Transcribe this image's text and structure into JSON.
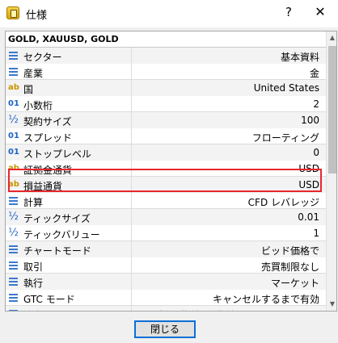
{
  "window": {
    "title": "仕様",
    "help": "?",
    "close": "✕"
  },
  "group": {
    "header": "GOLD, XAUUSD, GOLD"
  },
  "rows": [
    {
      "icon": "list-icon",
      "name": "セクター",
      "value": "基本資料"
    },
    {
      "icon": "list-icon",
      "name": "産業",
      "value": "金"
    },
    {
      "icon": "text-icon",
      "name": "国",
      "value": "United States"
    },
    {
      "icon": "integer-icon",
      "name": "小数桁",
      "value": "2"
    },
    {
      "icon": "fraction-icon",
      "name": "契約サイズ",
      "value": "100"
    },
    {
      "icon": "integer-icon",
      "name": "スプレッド",
      "value": "フローティング"
    },
    {
      "icon": "integer-icon",
      "name": "ストップレベル",
      "value": "0"
    },
    {
      "icon": "text-icon",
      "name": "証拠金通貨",
      "value": "USD"
    },
    {
      "icon": "text-icon",
      "name": "損益通貨",
      "value": "USD"
    },
    {
      "icon": "list-icon",
      "name": "計算",
      "value": "CFD レバレッジ"
    },
    {
      "icon": "fraction-icon",
      "name": "ティックサイズ",
      "value": "0.01"
    },
    {
      "icon": "fraction-icon",
      "name": "ティックバリュー",
      "value": "1"
    },
    {
      "icon": "list-icon",
      "name": "チャートモード",
      "value": "ビッド価格で"
    },
    {
      "icon": "list-icon",
      "name": "取引",
      "value": "売買制限なし"
    },
    {
      "icon": "list-icon",
      "name": "執行",
      "value": "マーケット"
    },
    {
      "icon": "list-icon",
      "name": "GTC モード",
      "value": "キャンセルするまで有効"
    },
    {
      "icon": "list-icon",
      "name": "注文",
      "value": "成行, 指値, 逆指値, ストップリミット"
    }
  ],
  "icons": {
    "text": "ab",
    "integer": "01",
    "fraction": "½"
  },
  "footer": {
    "ok_label": "閉じる"
  },
  "colors": {
    "highlight": "#e8262d",
    "button_border": "#0a6fd6"
  }
}
